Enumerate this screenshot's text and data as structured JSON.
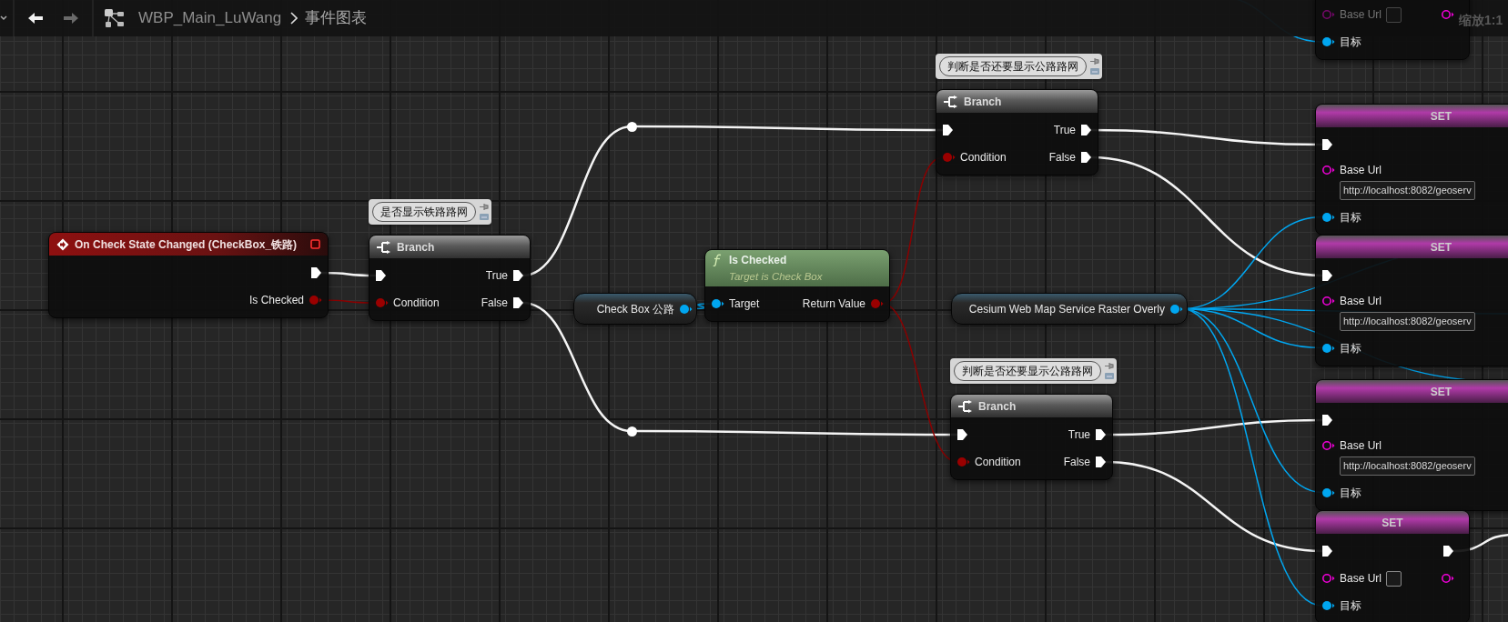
{
  "toolbar": {
    "back": {
      "disabled": false
    },
    "forward": {
      "disabled": true
    },
    "breadcrumb": [
      "WBP_Main_LuWang",
      "事件图表"
    ]
  },
  "zoom_label": "缩放1:1",
  "nodes": [
    {
      "kind": "set",
      "rows": [
        {
          "in": {
            "kind": "string",
            "label": "Base Url",
            "connected": false,
            "has_field": true
          },
          "out": {
            "kind": "string",
            "connected": false
          }
        },
        {
          "in": {
            "kind": "object",
            "label": "目标",
            "connected": true
          }
        }
      ]
    },
    {
      "kind": "branch",
      "title": "Branch",
      "comment": "判断是否还要显示公路路网",
      "rows": [
        {
          "in": {
            "kind": "exec",
            "connected": true
          },
          "out": {
            "kind": "exec",
            "label": "True",
            "connected": true
          }
        },
        {
          "in": {
            "kind": "bool",
            "label": "Condition",
            "connected": true
          },
          "out": {
            "kind": "exec",
            "label": "False",
            "connected": true
          }
        }
      ]
    },
    {
      "kind": "set",
      "title": "SET",
      "rows": [
        {
          "in": {
            "kind": "exec",
            "connected": true
          }
        },
        {
          "in": {
            "kind": "string",
            "label": "Base Url",
            "connected": false,
            "value": "http://localhost:8082/geoserv"
          }
        },
        {
          "in": {
            "kind": "object",
            "label": "目标",
            "connected": true
          }
        }
      ]
    },
    {
      "kind": "event",
      "title": "On Check State Changed (CheckBox_铁路)",
      "rows": [
        {
          "out": {
            "kind": "exec",
            "connected": true
          }
        },
        {
          "out": {
            "kind": "bool",
            "label": "Is Checked",
            "connected": true
          }
        }
      ]
    },
    {
      "kind": "branch",
      "title": "Branch",
      "comment": "是否显示铁路路网",
      "rows": [
        {
          "in": {
            "kind": "exec",
            "connected": true
          },
          "out": {
            "kind": "exec",
            "label": "True",
            "connected": true
          }
        },
        {
          "in": {
            "kind": "bool",
            "label": "Condition",
            "connected": true
          },
          "out": {
            "kind": "exec",
            "label": "False",
            "connected": true
          }
        }
      ]
    },
    {
      "kind": "set",
      "title": "SET",
      "rows": [
        {
          "in": {
            "kind": "exec",
            "connected": true
          }
        },
        {
          "in": {
            "kind": "string",
            "label": "Base Url",
            "connected": false,
            "value": "http://localhost:8082/geoserv"
          }
        },
        {
          "in": {
            "kind": "object",
            "label": "目标",
            "connected": true
          }
        }
      ]
    },
    {
      "kind": "function",
      "title": "Is Checked",
      "subtitle": "Target is Check Box",
      "rows": [
        {
          "in": {
            "kind": "object",
            "label": "Target",
            "connected": true
          },
          "out": {
            "kind": "bool",
            "label": "Return Value",
            "connected": true
          }
        }
      ]
    },
    {
      "kind": "variable",
      "rows": [
        {
          "out": {
            "kind": "object",
            "label": "Check Box 公路",
            "connected": true
          }
        }
      ]
    },
    {
      "kind": "variable",
      "rows": [
        {
          "out": {
            "kind": "object",
            "label": "Cesium Web Map Service Raster Overly",
            "connected": true
          }
        }
      ]
    },
    {
      "kind": "set",
      "title": "SET",
      "rows": [
        {
          "in": {
            "kind": "exec",
            "connected": true
          }
        },
        {
          "in": {
            "kind": "string",
            "label": "Base Url",
            "connected": false,
            "value": "http://localhost:8082/geoserv"
          }
        },
        {
          "in": {
            "kind": "object",
            "label": "目标",
            "connected": true
          }
        }
      ]
    },
    {
      "kind": "branch",
      "title": "Branch",
      "comment": "判断是否还要显示公路路网",
      "rows": [
        {
          "in": {
            "kind": "exec",
            "connected": true
          },
          "out": {
            "kind": "exec",
            "label": "True",
            "connected": true
          }
        },
        {
          "in": {
            "kind": "bool",
            "label": "Condition",
            "connected": true
          },
          "out": {
            "kind": "exec",
            "label": "False",
            "connected": true
          }
        }
      ]
    },
    {
      "kind": "set",
      "title": "SET",
      "rows": [
        {
          "in": {
            "kind": "exec",
            "connected": true
          },
          "out": {
            "kind": "exec",
            "connected": true
          }
        },
        {
          "in": {
            "kind": "string",
            "label": "Base Url",
            "connected": false,
            "has_field": true
          },
          "out": {
            "kind": "string",
            "connected": false
          }
        },
        {
          "in": {
            "kind": "object",
            "label": "目标",
            "connected": true
          }
        }
      ]
    }
  ]
}
